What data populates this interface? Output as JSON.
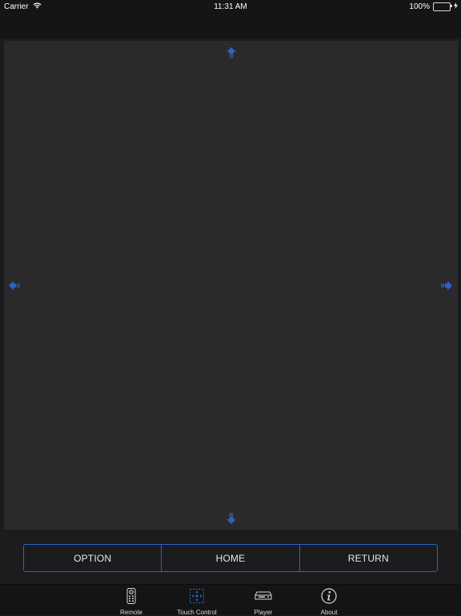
{
  "status_bar": {
    "carrier": "Carrier",
    "time": "11:31 AM",
    "battery": "100%",
    "battery_level": 1.0
  },
  "touchpad": {
    "arrow_icons": [
      "arrow-up-icon",
      "arrow-down-icon",
      "arrow-left-icon",
      "arrow-right-icon"
    ],
    "accent": "#2d62c8"
  },
  "controls": {
    "option": "OPTION",
    "home": "HOME",
    "return": "RETURN"
  },
  "tabs": [
    {
      "label": "Remote",
      "icon": "remote-icon"
    },
    {
      "label": "Touch Control",
      "icon": "touch-control-icon",
      "selected": true
    },
    {
      "label": "Player",
      "icon": "player-icon"
    },
    {
      "label": "About",
      "icon": "about-icon"
    }
  ],
  "colors": {
    "accent": "#2d62c8",
    "background": "#1c1c1e",
    "pad": "#2a2a2c",
    "battery": "#4cd964"
  }
}
